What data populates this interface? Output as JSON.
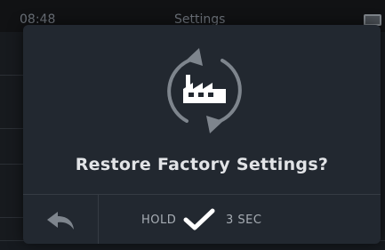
{
  "status_bar": {
    "time": "08:48",
    "title": "Settings"
  },
  "dialog": {
    "icon": "factory-restore-icon",
    "message": "Restore Factory Settings?",
    "back_icon": "back-arrow-icon",
    "hold_label": "HOLD",
    "confirm_icon": "checkmark-icon",
    "hold_duration": "3 SEC"
  },
  "colors": {
    "background": "#0c0d0f",
    "dialog_bg": "#222830",
    "icon_gray": "#7e858d",
    "text": "#e2e4e7",
    "footer_text": "#a7adb4"
  }
}
